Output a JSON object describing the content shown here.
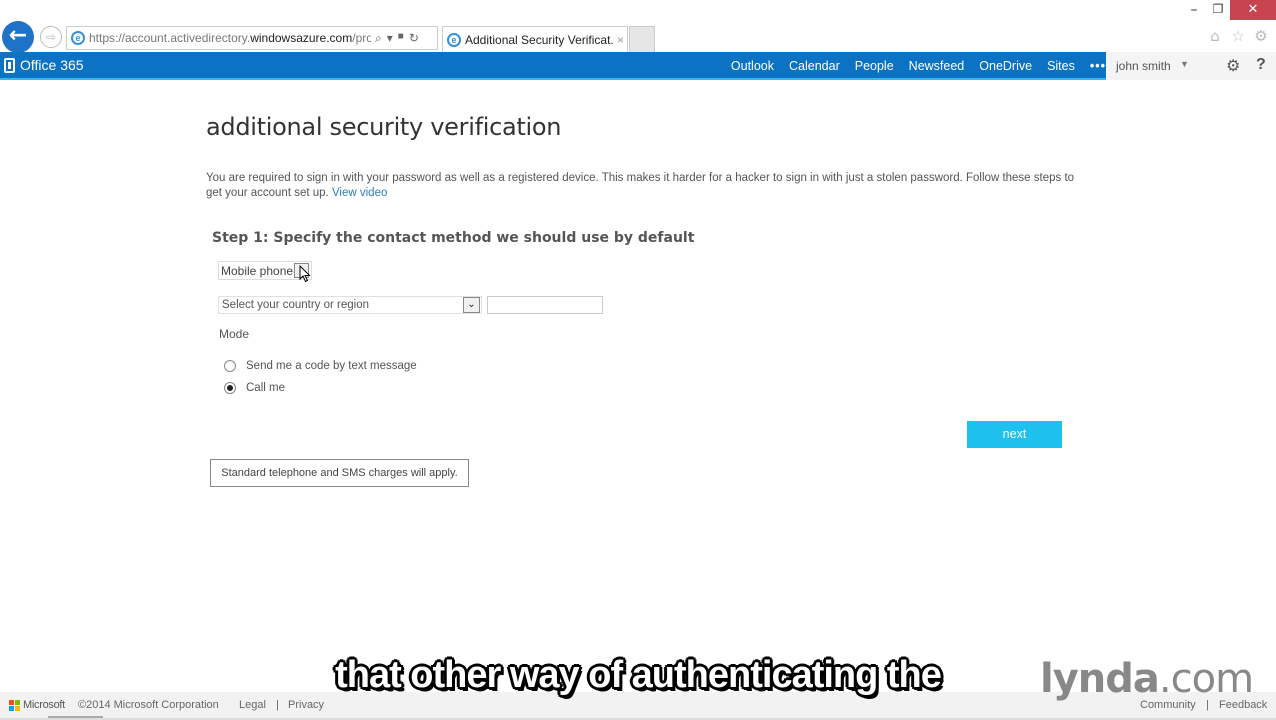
{
  "browser": {
    "url_prefix": "https://account.activedirectory.",
    "url_domain": "windowsazure.com",
    "url_suffix": "/proo",
    "tab_title": "Additional Security Verificat...",
    "tab_close": "×",
    "back_glyph": "←",
    "forward_glyph": "⇨",
    "addr_tools": [
      "⌕",
      "▾",
      "🔒",
      "↻"
    ],
    "window": {
      "minimize": "–",
      "restore": "❐",
      "close": "✕"
    },
    "toolbar_icons": {
      "home": "⌂",
      "favorites": "☆",
      "tools": "⚙"
    }
  },
  "suite": {
    "brand": "Office 365",
    "nav": [
      "Outlook",
      "Calendar",
      "People",
      "Newsfeed",
      "OneDrive",
      "Sites"
    ],
    "more": "•••",
    "user_name": "john smith",
    "user_caret": "▼",
    "settings_glyph": "⚙",
    "help_glyph": "?"
  },
  "page": {
    "title": "additional security verification",
    "intro": "You are required to sign in with your password as well as a registered device. This makes it harder for a hacker to sign in with just a stolen password. Follow these steps to get your account set up.",
    "view_video": "View video",
    "step_title": "Step 1: Specify the contact method we should use by default",
    "method_value": "Mobile phone",
    "country_placeholder": "Select your country or region",
    "phone_value": "",
    "mode_label": "Mode",
    "mode_options": [
      {
        "label": "Send me a code by text message",
        "checked": false
      },
      {
        "label": "Call me",
        "checked": true
      }
    ],
    "next_label": "next",
    "charges_note": "Standard telephone and SMS charges will apply."
  },
  "footer": {
    "ms_word": "Microsoft",
    "ms_colors": [
      "#f25022",
      "#7fba00",
      "#00a4ef",
      "#ffb900"
    ],
    "copyright": "©2014 Microsoft Corporation",
    "legal": "Legal",
    "separator": "|",
    "privacy": "Privacy",
    "community": "Community",
    "feedback": "Feedback"
  },
  "overlay": {
    "subtitle": "that other way of authenticating the",
    "watermark_bold": "lynda",
    "watermark_rest": ".com"
  },
  "colors": {
    "suite_blue": "#0b72c4",
    "next_button": "#1ec1ee",
    "link": "#2a7dc2",
    "close_red": "#c7434f"
  }
}
